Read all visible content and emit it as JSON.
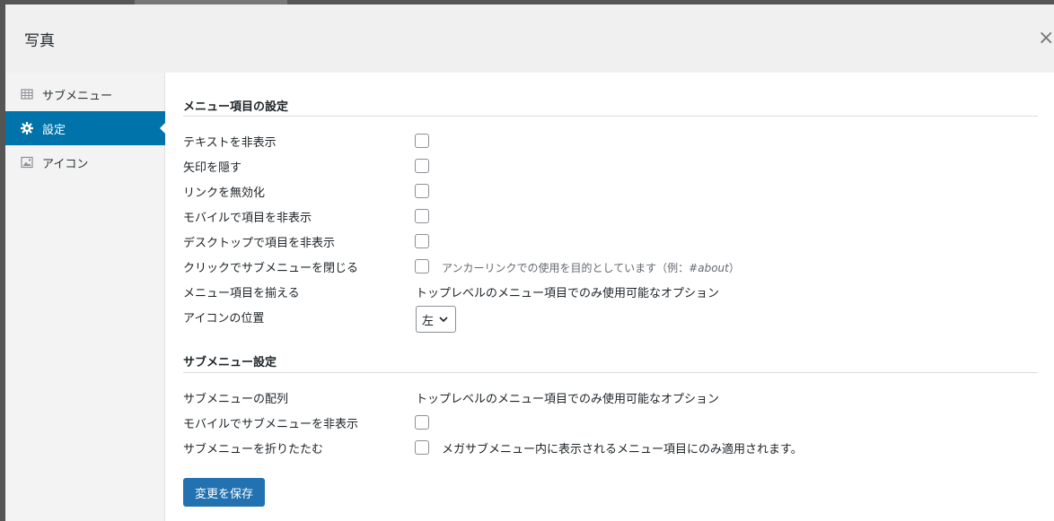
{
  "modal": {
    "title": "写真",
    "close_glyph": "×"
  },
  "sidebar": {
    "items": [
      {
        "label": "サブメニュー",
        "icon": "grid-icon"
      },
      {
        "label": "設定",
        "icon": "gear-icon"
      },
      {
        "label": "アイコン",
        "icon": "image-icon"
      }
    ],
    "active_index": 1,
    "active_color": "#0073aa"
  },
  "menu_settings": {
    "title": "メニュー項目の設定",
    "rows": [
      {
        "label": "テキストを非表示",
        "checked": false
      },
      {
        "label": "矢印を隠す",
        "checked": false
      },
      {
        "label": "リンクを無効化",
        "checked": false
      },
      {
        "label": "モバイルで項目を非表示",
        "checked": false
      },
      {
        "label": "デスクトップで項目を非表示",
        "checked": false
      },
      {
        "label": "クリックでサブメニューを閉じる",
        "checked": false,
        "note_prefix": "アンカーリンクでの使用を目的としています（例：",
        "note_example": "#about",
        "note_suffix": "）"
      }
    ],
    "align_label": "メニュー項目を揃える",
    "align_value": "トップレベルのメニュー項目でのみ使用可能なオプション",
    "icon_position_label": "アイコンの位置",
    "icon_position_value": "左"
  },
  "submenu_settings": {
    "title": "サブメニュー設定",
    "alignment_label": "サブメニューの配列",
    "alignment_value": "トップレベルのメニュー項目でのみ使用可能なオプション",
    "hide_mobile_label": "モバイルでサブメニューを非表示",
    "collapse_label": "サブメニューを折りたたむ",
    "collapse_note": "メガサブメニュー内に表示されるメニュー項目にのみ適用されます。"
  },
  "save_label": "変更を保存",
  "save_color": "#2271b1"
}
